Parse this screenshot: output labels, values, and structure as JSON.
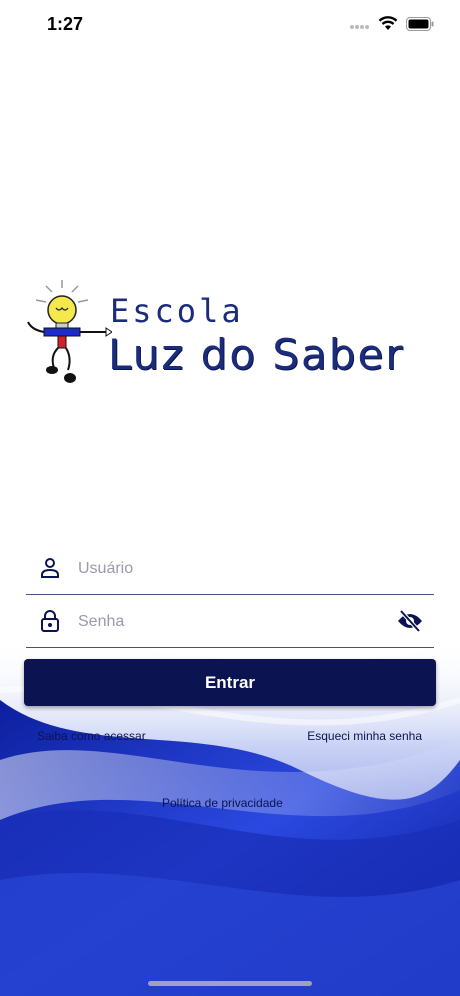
{
  "status_bar": {
    "time": "1:27"
  },
  "logo": {
    "line1": "Escola",
    "line2": "Luz do Saber"
  },
  "form": {
    "username_placeholder": "Usuário",
    "password_placeholder": "Senha",
    "submit_label": "Entrar"
  },
  "links": {
    "how_to_access": "Saiba como acessar",
    "forgot_password": "Esqueci minha senha",
    "privacy_policy": "Política de privacidade"
  },
  "colors": {
    "brand_navy": "#0b1450",
    "logo_blue": "#1b2c7c",
    "wave_blue": "#1f3bd0"
  },
  "icons": {
    "user_field": "user-icon",
    "password_field": "lock-icon",
    "password_toggle": "eye-off-icon"
  }
}
